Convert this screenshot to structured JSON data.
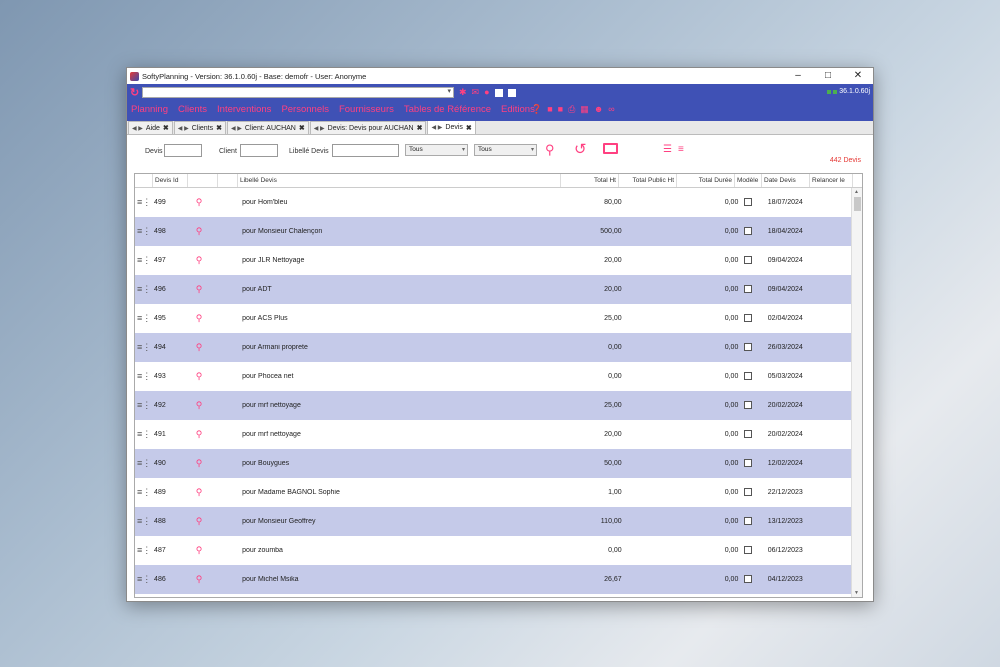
{
  "window": {
    "title": "SoftyPlanning - Version: 36.1.0.60j - Base: demofr - User: Anonyme"
  },
  "toolbar": {
    "version": "36.1.0.60j"
  },
  "menu": [
    "Planning",
    "Clients",
    "Interventions",
    "Personnels",
    "Fournisseurs",
    "Tables de Référence",
    "Editions"
  ],
  "tabs": [
    {
      "label": "Aide",
      "active": false
    },
    {
      "label": "Clients",
      "active": false
    },
    {
      "label": "Client: AUCHAN",
      "active": false
    },
    {
      "label": "Devis: Devis pour AUCHAN",
      "active": false
    },
    {
      "label": "Devis",
      "active": true
    }
  ],
  "filters": {
    "devis_label": "Devis",
    "client_label": "Client",
    "libelle_label": "Libellé Devis",
    "select1": "Tous",
    "select2": "Tous",
    "count": "442 Devis"
  },
  "columns": [
    "Devis Id",
    "Libellé Devis",
    "Total Ht",
    "Total Public Ht",
    "Total Durée",
    "Modèle",
    "Date Devis",
    "Relancer le"
  ],
  "rows": [
    {
      "id": "499",
      "libelle": "pour Hom'bleu",
      "total_ht": "80,00",
      "duree": "0,00",
      "date": "18/07/2024"
    },
    {
      "id": "498",
      "libelle": "pour Monsieur Chalençon",
      "total_ht": "500,00",
      "duree": "0,00",
      "date": "18/04/2024"
    },
    {
      "id": "497",
      "libelle": "pour JLR Nettoyage",
      "total_ht": "20,00",
      "duree": "0,00",
      "date": "09/04/2024"
    },
    {
      "id": "496",
      "libelle": "pour ADT",
      "total_ht": "20,00",
      "duree": "0,00",
      "date": "09/04/2024"
    },
    {
      "id": "495",
      "libelle": "pour ACS Plus",
      "total_ht": "25,00",
      "duree": "0,00",
      "date": "02/04/2024"
    },
    {
      "id": "494",
      "libelle": "pour Armani proprete",
      "total_ht": "0,00",
      "duree": "0,00",
      "date": "26/03/2024"
    },
    {
      "id": "493",
      "libelle": "pour Phocea net",
      "total_ht": "0,00",
      "duree": "0,00",
      "date": "05/03/2024"
    },
    {
      "id": "492",
      "libelle": "pour mrf nettoyage",
      "total_ht": "25,00",
      "duree": "0,00",
      "date": "20/02/2024"
    },
    {
      "id": "491",
      "libelle": "pour mrf nettoyage",
      "total_ht": "20,00",
      "duree": "0,00",
      "date": "20/02/2024"
    },
    {
      "id": "490",
      "libelle": "pour Bouygues",
      "total_ht": "50,00",
      "duree": "0,00",
      "date": "12/02/2024"
    },
    {
      "id": "489",
      "libelle": "pour Madame BAGNOL Sophie",
      "total_ht": "1,00",
      "duree": "0,00",
      "date": "22/12/2023"
    },
    {
      "id": "488",
      "libelle": "pour Monsieur Geoffrey",
      "total_ht": "110,00",
      "duree": "0,00",
      "date": "13/12/2023"
    },
    {
      "id": "487",
      "libelle": "pour zoumba",
      "total_ht": "0,00",
      "duree": "0,00",
      "date": "06/12/2023"
    },
    {
      "id": "486",
      "libelle": "pour Michel Msika",
      "total_ht": "26,67",
      "duree": "0,00",
      "date": "04/12/2023"
    }
  ]
}
